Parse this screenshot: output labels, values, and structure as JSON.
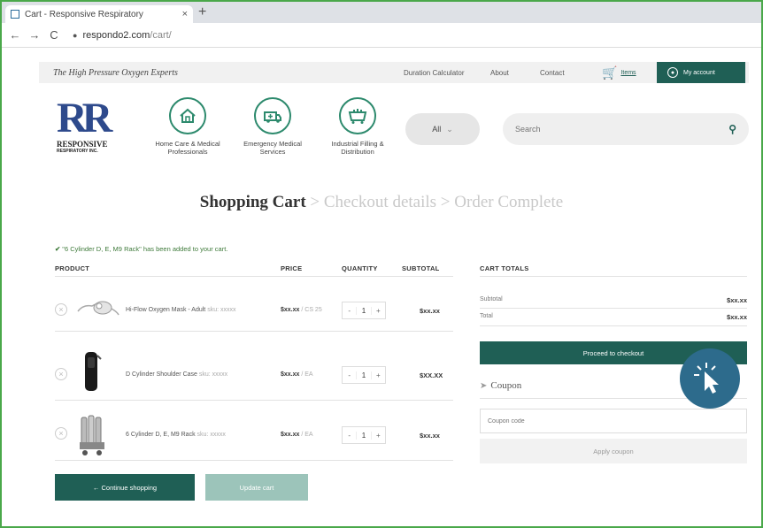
{
  "browser": {
    "tab_title": "Cart - Responsive Respiratory",
    "tab_close": "×",
    "new_tab": "+",
    "nav_back": "←",
    "nav_forward": "→",
    "nav_reload": "C",
    "url_host": "respondo2.com",
    "url_path": "/cart/"
  },
  "topbar": {
    "tagline": "The High Pressure Oxygen Experts",
    "links": [
      "Duration Calculator",
      "About",
      "Contact"
    ],
    "cart_label": "Items",
    "account_label": "My account"
  },
  "logo": {
    "mark": "RR",
    "name": "RESPONSIVE",
    "sub": "RESPIRATORY INC."
  },
  "categories": [
    {
      "label": "Home Care & Medical Professionals",
      "icon": "house-icon"
    },
    {
      "label": "Emergency Medical Services",
      "icon": "ambulance-icon"
    },
    {
      "label": "Industrial Filling & Distribution",
      "icon": "cylinder-rack-icon"
    }
  ],
  "search": {
    "all_label": "All",
    "placeholder": "Search"
  },
  "steps": {
    "current": "Shopping Cart",
    "sep": ">",
    "step2": "Checkout details",
    "step3": "Order Complete"
  },
  "notice": "\"6 Cylinder D, E, M9 Rack\" has been added to your cart.",
  "table": {
    "headers": [
      "PRODUCT",
      "PRICE",
      "QUANTITY",
      "SUBTOTAL"
    ],
    "rows": [
      {
        "name": "Hi-Flow Oxygen Mask - Adult",
        "name_muted": "sku: xxxxx",
        "price": "$xx.xx",
        "price_muted": "/ CS 25",
        "qty": "1",
        "subtotal": "$xx.xx"
      },
      {
        "name": "D Cylinder Shoulder Case",
        "name_muted": "sku: xxxxx",
        "price": "$xx.xx",
        "price_muted": "/ EA",
        "qty": "1",
        "subtotal": "$XX.XX"
      },
      {
        "name": "6 Cylinder D, E, M9 Rack",
        "name_muted": "sku: xxxxx",
        "price": "$xx.xx",
        "price_muted": "/ EA",
        "qty": "1",
        "subtotal": "$xx.xx"
      }
    ],
    "remove_glyph": "×",
    "qty_minus": "-",
    "qty_plus": "+"
  },
  "buttons": {
    "continue": "← Continue shopping",
    "update": "Update cart"
  },
  "totals": {
    "title": "CART TOTALS",
    "subtotal_label": "Subtotal",
    "subtotal_value": "$xx.xx",
    "total_label": "Total",
    "total_value": "$xx.xx",
    "checkout": "Proceed to checkout"
  },
  "coupon": {
    "title": "Coupon",
    "placeholder": "Coupon code",
    "apply": "Apply coupon"
  },
  "colors": {
    "brand_green": "#1f5f55",
    "light_green": "#9cc4ba",
    "notice_green": "#3e7a3a",
    "logo_blue": "#2e4a8c",
    "cursor_badge": "#2d6b8c",
    "frame_border": "#4aa84a"
  }
}
